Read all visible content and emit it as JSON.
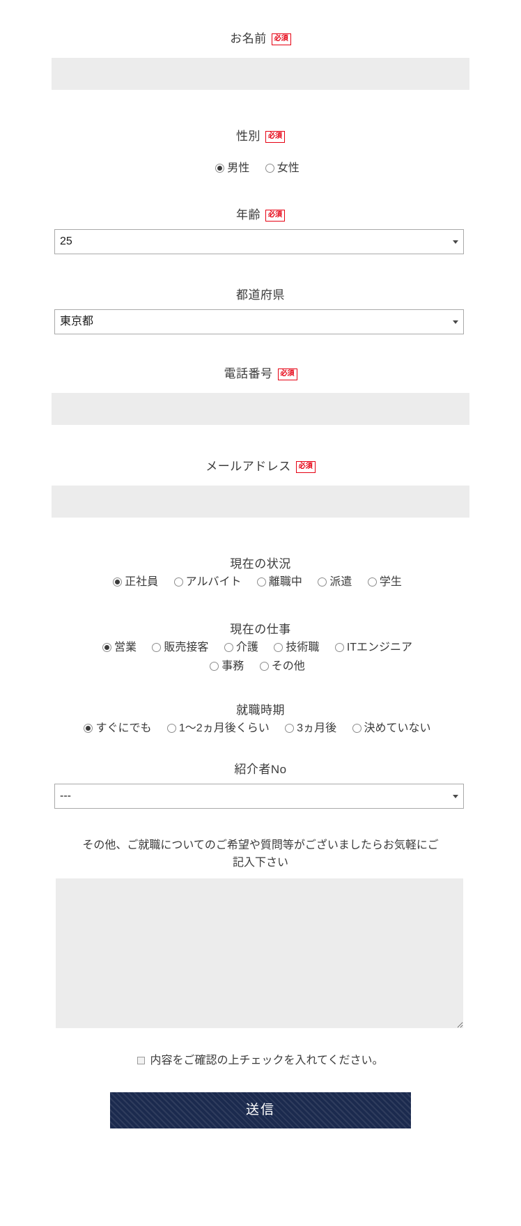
{
  "form": {
    "required_badge": "必須",
    "fields": {
      "name": {
        "label": "お名前",
        "required": true,
        "value": "",
        "placeholder": ""
      },
      "gender": {
        "label": "性別",
        "required": true,
        "options": [
          {
            "label": "男性",
            "checked": true
          },
          {
            "label": "女性",
            "checked": false
          }
        ]
      },
      "age": {
        "label": "年齢",
        "required": true,
        "value": "25",
        "arrow_icon": "chevron-down-icon"
      },
      "prefecture": {
        "label": "都道府県",
        "required": false,
        "value": "東京都",
        "arrow_icon": "chevron-down-icon"
      },
      "phone": {
        "label": "電話番号",
        "required": true,
        "value": "",
        "placeholder": ""
      },
      "email": {
        "label": "メールアドレス",
        "required": true,
        "value": "",
        "placeholder": ""
      },
      "current_status": {
        "label": "現在の状況",
        "required": false,
        "options": [
          {
            "label": "正社員",
            "checked": true
          },
          {
            "label": "アルバイト",
            "checked": false
          },
          {
            "label": "離職中",
            "checked": false
          },
          {
            "label": "派遣",
            "checked": false
          },
          {
            "label": "学生",
            "checked": false
          }
        ]
      },
      "current_job": {
        "label": "現在の仕事",
        "required": false,
        "options_row1": [
          {
            "label": "営業",
            "checked": true
          },
          {
            "label": "販売接客",
            "checked": false
          },
          {
            "label": "介護",
            "checked": false
          },
          {
            "label": "技術職",
            "checked": false
          },
          {
            "label": "ITエンジニア",
            "checked": false
          }
        ],
        "options_row2": [
          {
            "label": "事務",
            "checked": false
          },
          {
            "label": "その他",
            "checked": false
          }
        ]
      },
      "timing": {
        "label": "就職時期",
        "required": false,
        "options": [
          {
            "label": "すぐにでも",
            "checked": true
          },
          {
            "label": "1〜2ヵ月後くらい",
            "checked": false
          },
          {
            "label": "3ヵ月後",
            "checked": false
          },
          {
            "label": "決めていない",
            "checked": false
          }
        ]
      },
      "referrer": {
        "label": "紹介者No",
        "required": false,
        "value": "---",
        "arrow_icon": "chevron-down-icon"
      },
      "note": {
        "label_line1": "その他、ご就職についてのご希望や質問等がございましたらお気軽にご",
        "label_line2": "記入下さい",
        "value": "",
        "placeholder": ""
      },
      "confirm": {
        "label": "内容をご確認の上チェックを入れてください。",
        "checked": false
      }
    },
    "submit": {
      "label": "送信",
      "background_color": "#1b2a4e",
      "text_color": "#ffffff"
    }
  }
}
